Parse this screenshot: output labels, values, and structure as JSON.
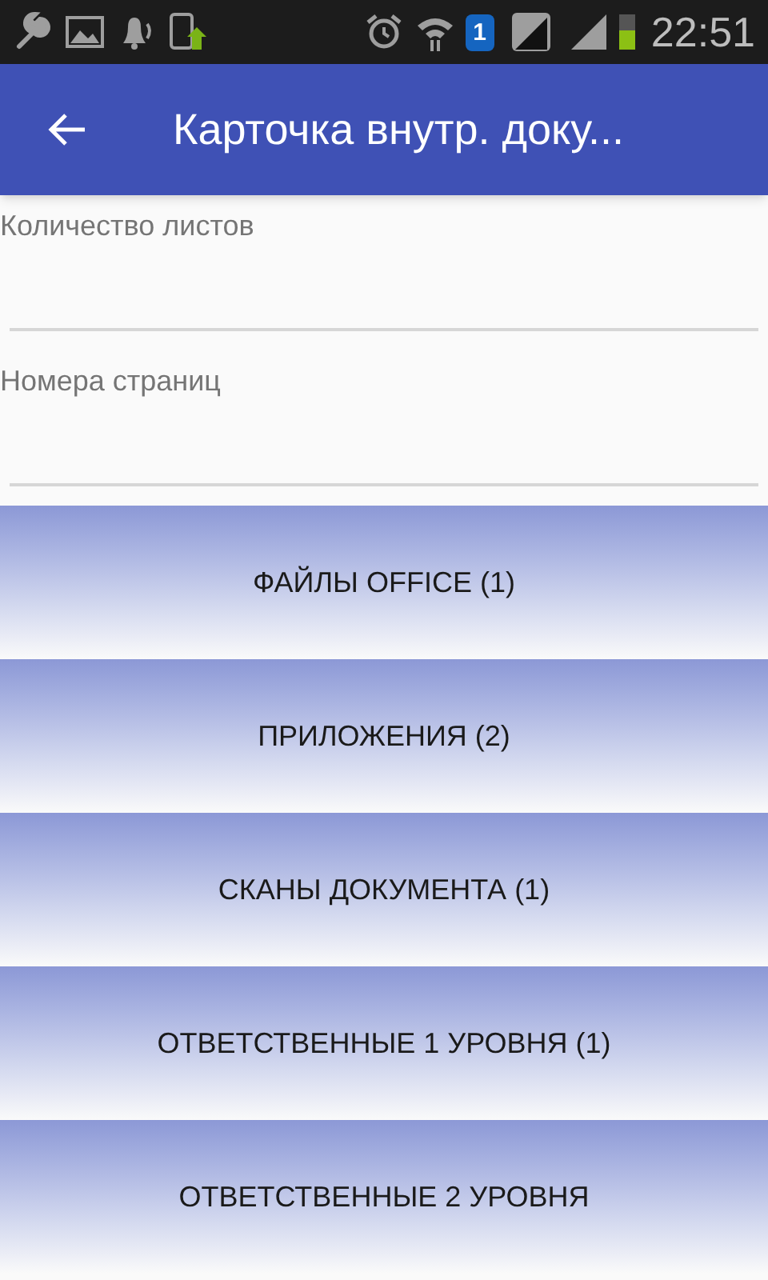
{
  "status_bar": {
    "sim_badge": "1",
    "time": "22:51"
  },
  "app_bar": {
    "title": "Карточка внутр. доку..."
  },
  "fields": [
    {
      "label": "Количество листов"
    },
    {
      "label": "Номера страниц"
    }
  ],
  "buttons": [
    "ФАЙЛЫ OFFICE (1)",
    "ПРИЛОЖЕНИЯ (2)",
    "СКАНЫ ДОКУМЕНТА (1)",
    "ОТВЕТСТВЕННЫЕ 1 УРОВНЯ (1)",
    "ОТВЕТСТВЕННЫЕ 2 УРОВНЯ"
  ]
}
